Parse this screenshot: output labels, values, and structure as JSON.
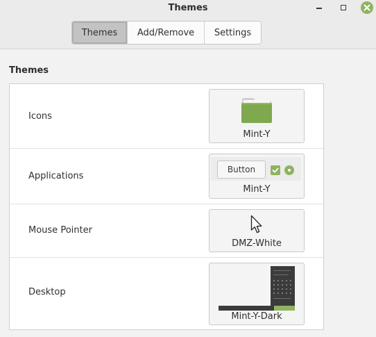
{
  "window": {
    "title": "Themes"
  },
  "tabs": [
    {
      "label": "Themes",
      "active": true
    },
    {
      "label": "Add/Remove",
      "active": false
    },
    {
      "label": "Settings",
      "active": false
    }
  ],
  "section": {
    "title": "Themes"
  },
  "rows": [
    {
      "label": "Icons",
      "value": "Mint-Y",
      "preview": "folder-icon"
    },
    {
      "label": "Applications",
      "value": "Mint-Y",
      "preview_button": "Button"
    },
    {
      "label": "Mouse Pointer",
      "value": "DMZ-White",
      "preview": "pointer-icon"
    },
    {
      "label": "Desktop",
      "value": "Mint-Y-Dark",
      "preview": "desktop-preview"
    }
  ],
  "colors": {
    "accent": "#8fb361",
    "active_tab": "#c3c3c3"
  }
}
